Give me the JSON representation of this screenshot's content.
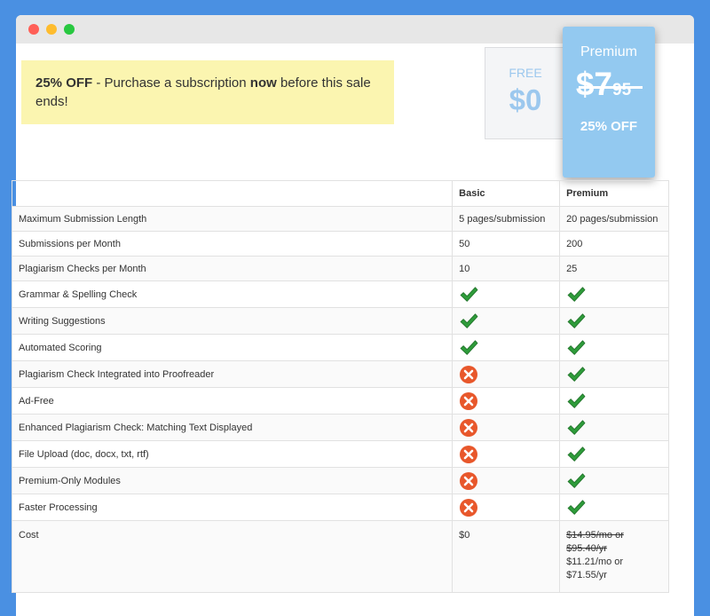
{
  "banner": {
    "percent": "25% OFF",
    "text_mid": " - Purchase a subscription ",
    "emphasis": "now",
    "text_end": " before this sale ends!"
  },
  "plans": {
    "free": {
      "name": "FREE",
      "price": "$0"
    },
    "premium": {
      "name": "Premium",
      "price_main": "$7",
      "price_cents": "95",
      "discount": "25% OFF"
    }
  },
  "table": {
    "headers": [
      "",
      "Basic",
      "Premium"
    ],
    "rows": [
      {
        "feature": "Maximum Submission Length",
        "basic": "5 pages/submission",
        "premium": "20 pages/submission"
      },
      {
        "feature": "Submissions per Month",
        "basic": "50",
        "premium": "200"
      },
      {
        "feature": "Plagiarism Checks per Month",
        "basic": "10",
        "premium": "25"
      },
      {
        "feature": "Grammar & Spelling Check",
        "basic": "check-icon",
        "premium": "check-icon"
      },
      {
        "feature": "Writing Suggestions",
        "basic": "check-icon",
        "premium": "check-icon"
      },
      {
        "feature": "Automated Scoring",
        "basic": "check-icon",
        "premium": "check-icon"
      },
      {
        "feature": "Plagiarism Check Integrated into Proofreader",
        "basic": "x-icon",
        "premium": "check-icon"
      },
      {
        "feature": "Ad-Free",
        "basic": "x-icon",
        "premium": "check-icon"
      },
      {
        "feature": "Enhanced Plagiarism Check: Matching Text Displayed",
        "basic": "x-icon",
        "premium": "check-icon"
      },
      {
        "feature": "File Upload (doc, docx, txt, rtf)",
        "basic": "x-icon",
        "premium": "check-icon"
      },
      {
        "feature": "Premium-Only Modules",
        "basic": "x-icon",
        "premium": "check-icon"
      },
      {
        "feature": "Faster Processing",
        "basic": "x-icon",
        "premium": "check-icon"
      }
    ],
    "cost": {
      "feature": "Cost",
      "basic": "$0",
      "premium_old_1": "$14.95/mo or",
      "premium_old_2": "$95.40/yr",
      "premium_new_1": "$11.21/mo or",
      "premium_new_2": "$71.55/yr"
    }
  },
  "colors": {
    "background": "#4a90e2",
    "banner": "#fbf5b0",
    "premium_card": "#93c9f0",
    "free_text": "#9cc8ee",
    "check": "#2e9b3a",
    "x": "#e8572b"
  }
}
